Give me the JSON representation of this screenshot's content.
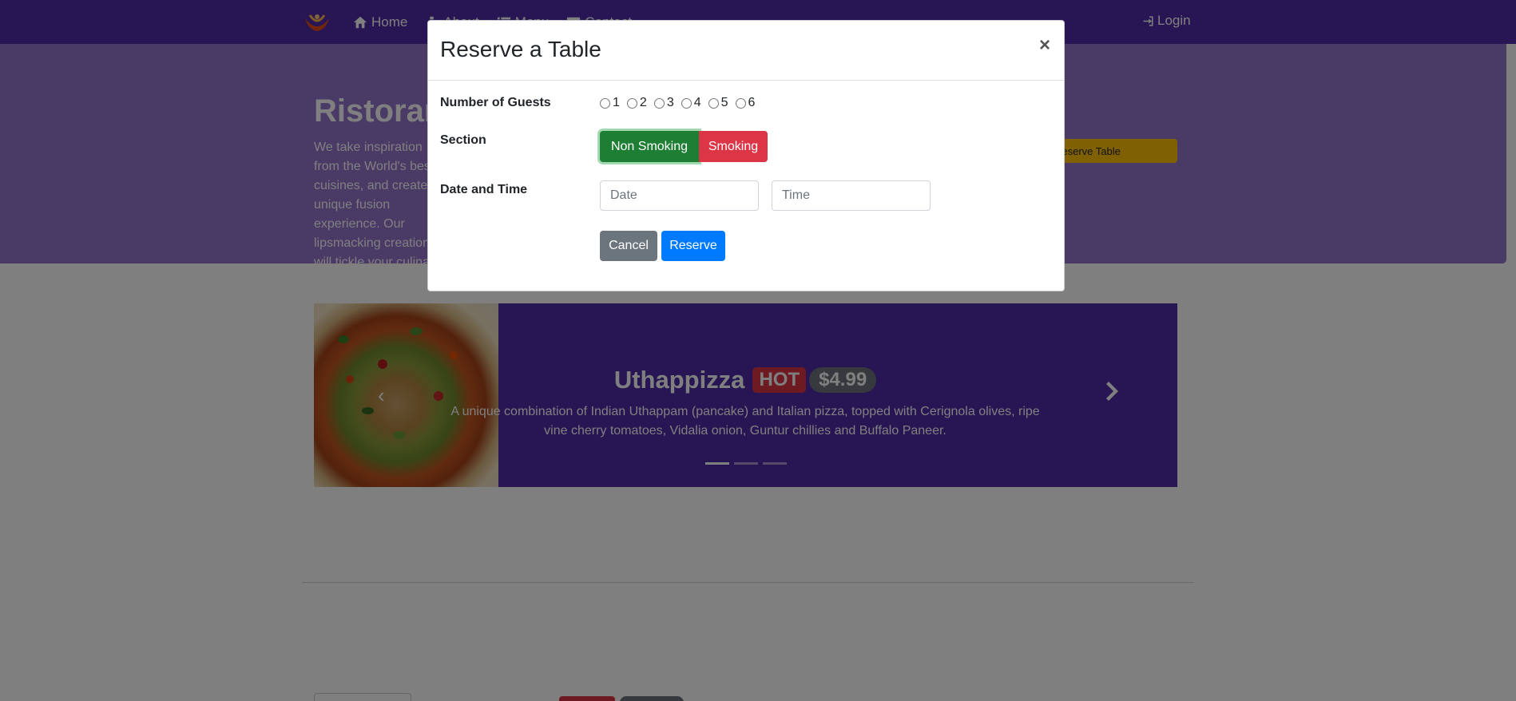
{
  "navbar": {
    "links": [
      {
        "label": "Home",
        "icon": "home-icon"
      },
      {
        "label": "About",
        "icon": "info-icon"
      },
      {
        "label": "Menu",
        "icon": "list-icon"
      },
      {
        "label": "Contact",
        "icon": "address-card-icon"
      }
    ],
    "login_label": "Login",
    "background": "#512da8"
  },
  "jumbotron": {
    "title": "Ristorante con Fusion",
    "text": "We take inspiration from the World's best cuisines, and create a unique fusion experience. Our lipsmacking creations will tickle your culinary senses!",
    "button_label": "Reserve Table",
    "background": "#9575cd"
  },
  "carousel": {
    "dish_name": "Uthappizza",
    "badge": "HOT",
    "price": "$4.99",
    "description": "A unique combination of Indian Uthappam (pancake) and Italian pizza, topped with Cerignola olives, ripe vine cherry tomatoes, Vidalia onion, Guntur chillies and Buffalo Paneer.",
    "slide_count": 3,
    "active_slide": 1
  },
  "modal": {
    "title": "Reserve a Table",
    "close_symbol": "×",
    "guests_label": "Number of Guests",
    "guest_options": [
      "1",
      "2",
      "3",
      "4",
      "5",
      "6"
    ],
    "section_label": "Section",
    "section_options": [
      "Non Smoking",
      "Smoking"
    ],
    "selected_section": "Non Smoking",
    "datetime_label": "Date and Time",
    "date_placeholder": "Date",
    "time_placeholder": "Time",
    "cancel_label": "Cancel",
    "reserve_label": "Reserve"
  },
  "colors": {
    "success": "#1e7e34",
    "danger": "#dc3545",
    "secondary": "#6c757d",
    "primary": "#007bff",
    "warning": "#ffc107"
  }
}
